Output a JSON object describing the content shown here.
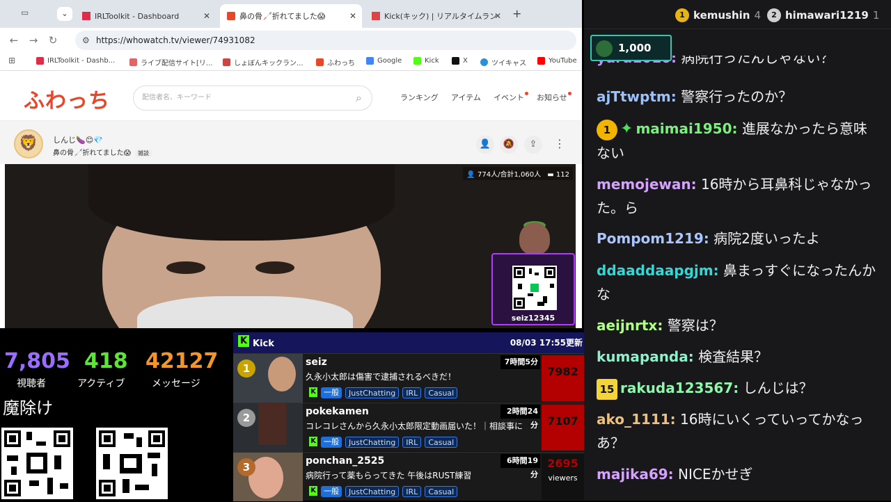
{
  "browser": {
    "tabs": [
      {
        "title": "IRLToolkit - Dashboard"
      },
      {
        "title": "鼻の骨🦯折れてました😱"
      },
      {
        "title": "Kick(キック) | リアルタイムラン"
      }
    ],
    "url": "https://whowatch.tv/viewer/74931082",
    "bookmarks": [
      "IRLToolkit - Dashb...",
      "ライブ配信サイト[リ...",
      "しょぼんキックラン...",
      "ふわっち",
      "Google",
      "Kick",
      "X",
      "ツイキャス",
      "YouTube"
    ]
  },
  "site": {
    "logo": "ふわっち",
    "search_placeholder": "配信者名、キーワード",
    "nav": [
      "ランキング",
      "アイテム",
      "イベント",
      "お知らせ"
    ],
    "broadcaster": "しんじ🍆😊💎",
    "title": "鼻の骨🦯折れてました😱",
    "tag": "雑談",
    "viewer_info": "774人/合計1,060人",
    "comment_count": "112",
    "qr_label": "seiz12345"
  },
  "stats": {
    "viewers": {
      "value": "7,805",
      "label": "視聴者",
      "color": "#9b6dff"
    },
    "active": {
      "value": "418",
      "label": "アクティブ",
      "color": "#5ee33a"
    },
    "messages": {
      "value": "42127",
      "label": "メッセージ",
      "color": "#f2962b"
    },
    "amulet": "魔除け"
  },
  "kick": {
    "title": "Kick",
    "updated": "08/03 17:55更新",
    "rows": [
      {
        "rank": "1",
        "name": "seiz",
        "time": "7時間5分",
        "title": "久永小太郎は傷害で逮捕されるべきだ！",
        "viewers": "7982",
        "genre": "一般",
        "tags": [
          "JustChatting",
          "IRL",
          "Casual"
        ],
        "rank_color": "#c9a400"
      },
      {
        "rank": "2",
        "name": "pokekamen",
        "time": "2時間24分",
        "title": "コレコレさんから久永小太郎限定動画届いた！｜相談事に",
        "viewers": "7107",
        "genre": "一般",
        "tags": [
          "JustChatting",
          "IRL",
          "Casual"
        ],
        "rank_color": "#9a9a9a"
      },
      {
        "rank": "3",
        "name": "ponchan_2525",
        "time": "6時間19分",
        "title": "病院行って薬もらってきた 午後はRUST練習",
        "viewers": "2695",
        "viewers_label": "viewers",
        "genre": "一般",
        "tags": [
          "JustChatting",
          "IRL",
          "Casual"
        ],
        "rank_color": "#b36a2a"
      }
    ]
  },
  "chat": {
    "gifters": [
      {
        "rank": "1",
        "name": "kemushin",
        "count": "4",
        "color": "#e7b416"
      },
      {
        "rank": "2",
        "name": "himawari1219",
        "count": "1",
        "color": "#cfcfcf"
      }
    ],
    "hype": "1,000",
    "messages": [
      {
        "user": "yuru1010:",
        "text": " 病院行ったんじゃない？",
        "color": "#bf94ff"
      },
      {
        "user": "ajTtwptm:",
        "text": " 警察行ったのか？",
        "color": "#9bc1ff"
      },
      {
        "user": "maimai1950:",
        "text": " 進展なかったら意味ない",
        "color": "#7cf07c",
        "badge": "1"
      },
      {
        "user": "memojewan:",
        "text": " 16時から耳鼻科じゃなかった。ら",
        "color": "#d6a2ff"
      },
      {
        "user": "Pompom1219:",
        "text": " 病院2度いったよ",
        "color": "#a9c6ff"
      },
      {
        "user": "ddaaddaapgjm:",
        "text": " 鼻まっすぐになったんかな",
        "color": "#34d6d6"
      },
      {
        "user": "aeijnrtx:",
        "text": " 警察は？",
        "color": "#b3ff8a"
      },
      {
        "user": "kumapanda:",
        "text": " 検査結果？",
        "color": "#8cf2c9"
      },
      {
        "user": "rakuda123567:",
        "text": " しんじは？",
        "color": "#8ef7ac",
        "badge": "15"
      },
      {
        "user": "ako_1111:",
        "text": " 16時にいくっていってかなっあ？",
        "color": "#f0c07a"
      },
      {
        "user": "majika69:",
        "text": " NICEかせぎ",
        "color": "#d6a2ff"
      }
    ]
  }
}
